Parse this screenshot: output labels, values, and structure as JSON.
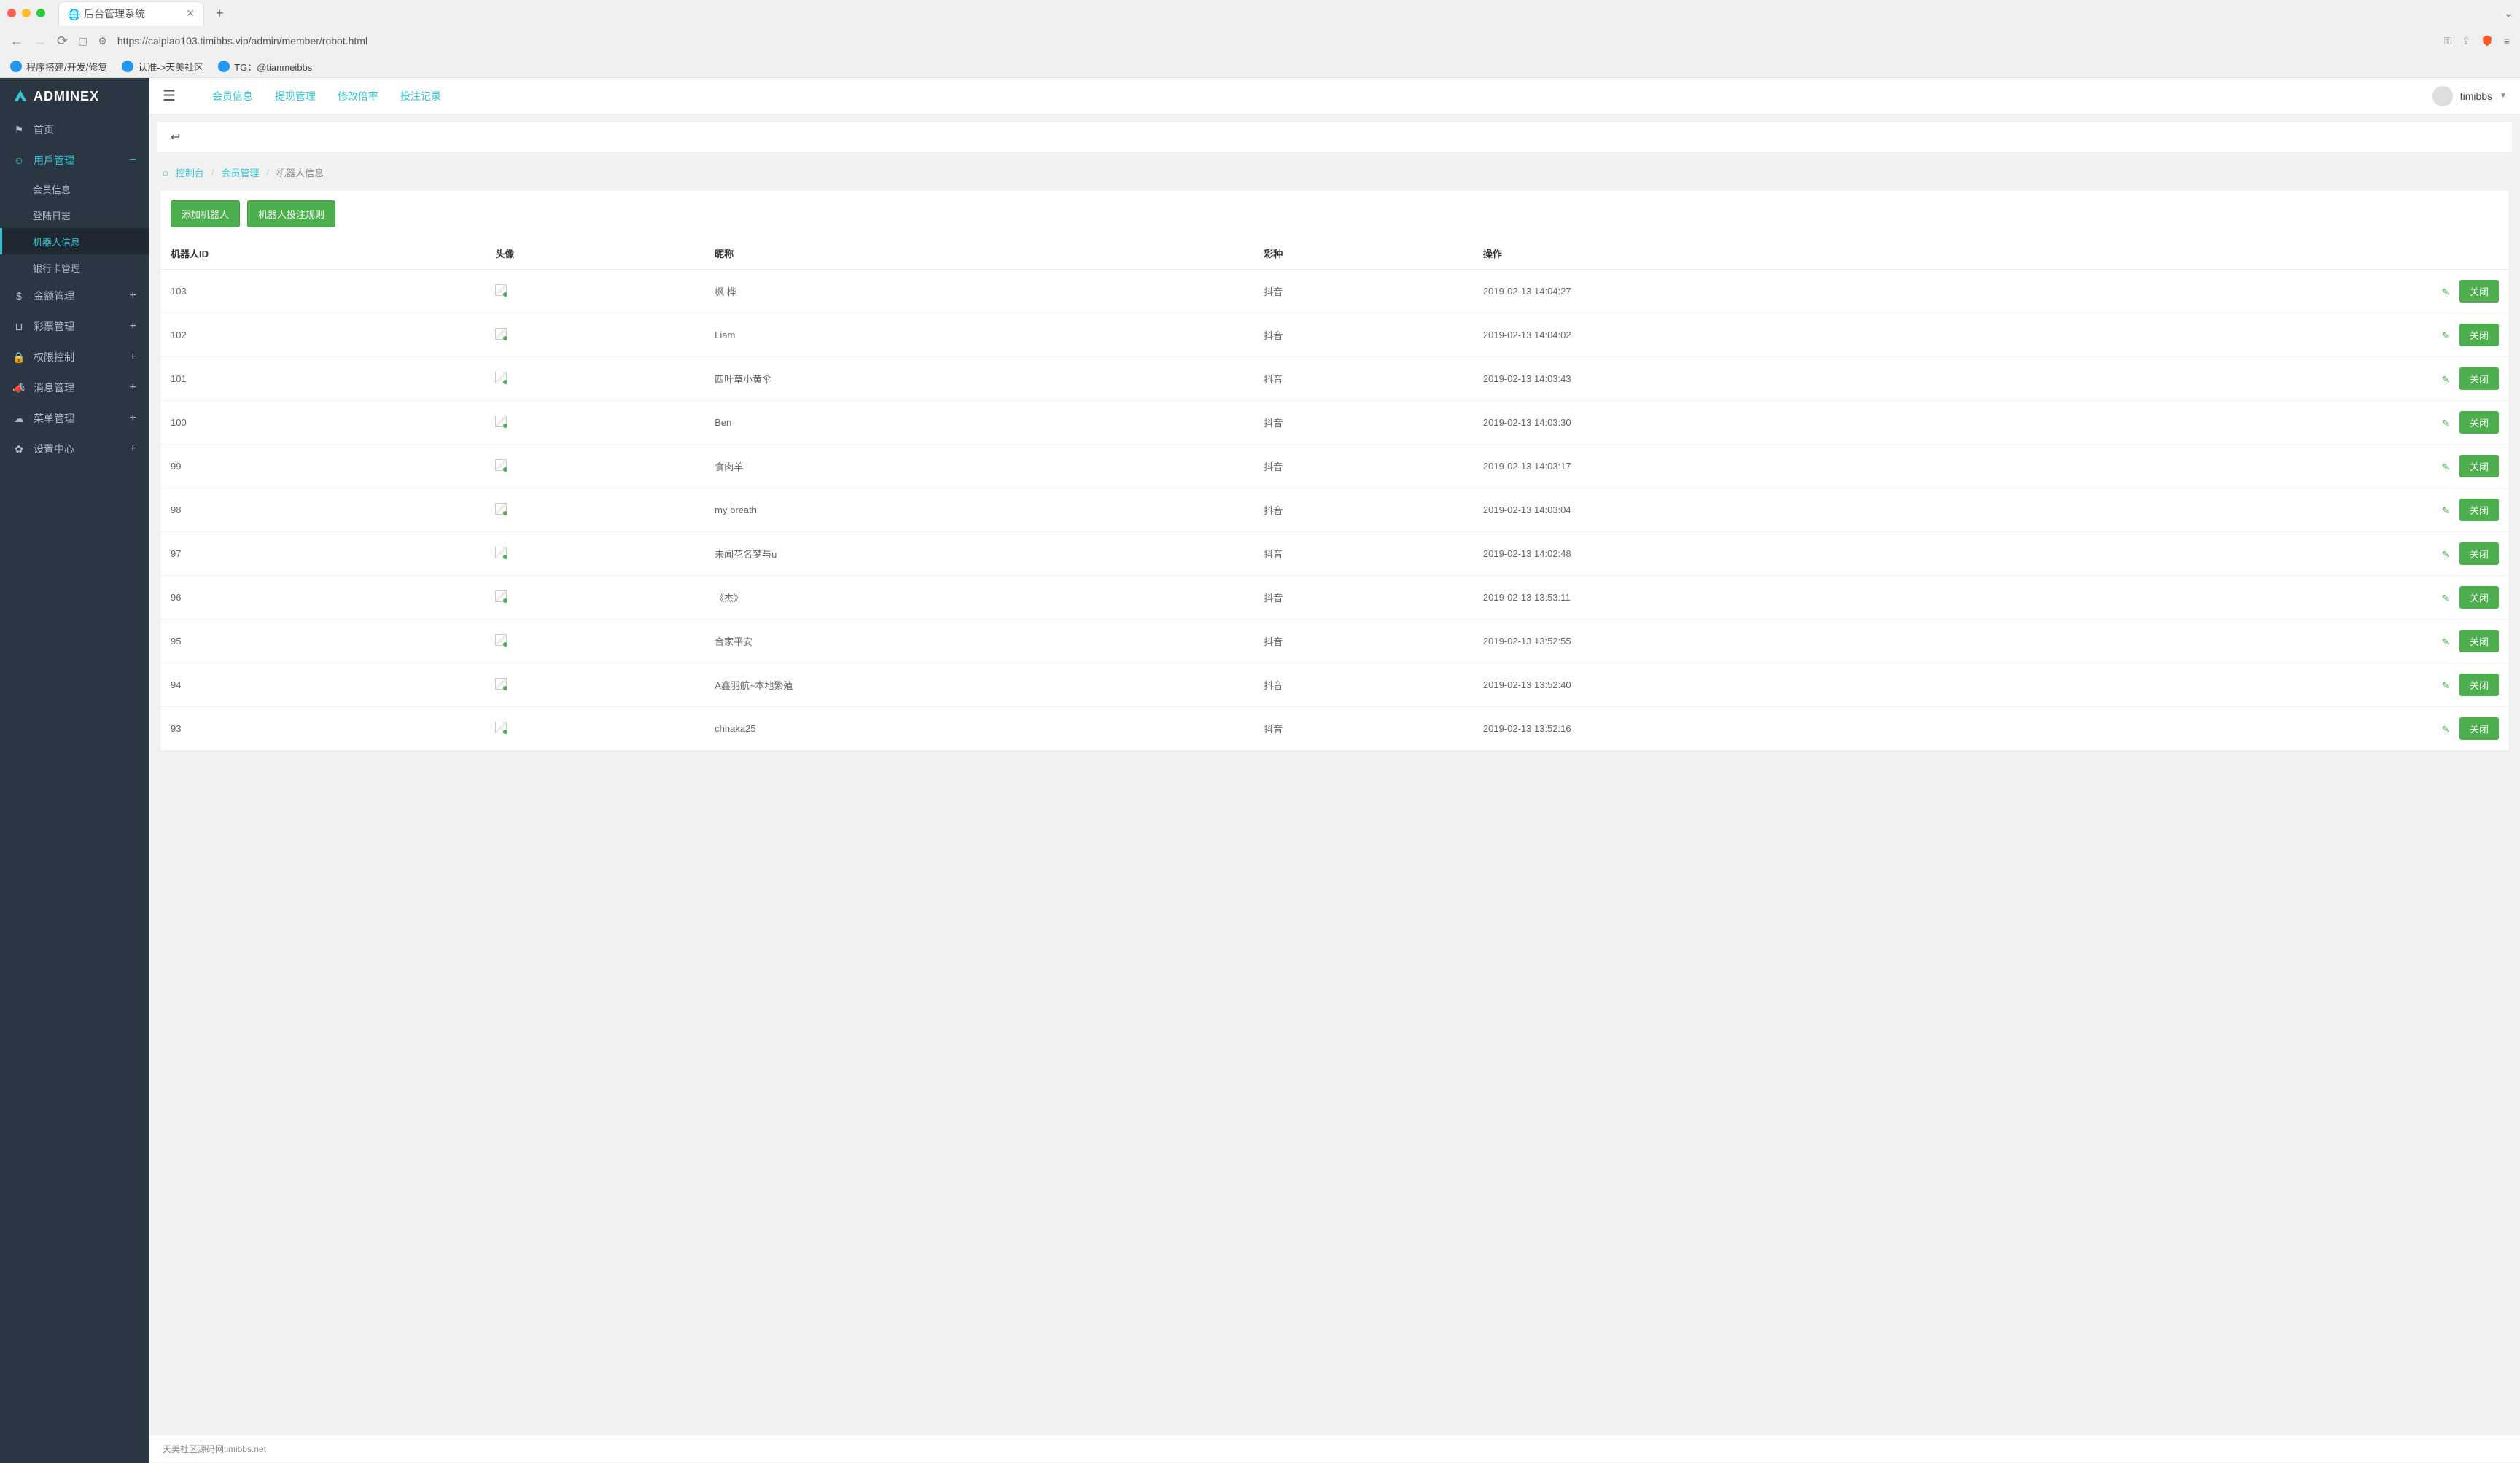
{
  "browser": {
    "tab_title": "后台管理系统",
    "url": "https://caipiao103.timibbs.vip/admin/member/robot.html",
    "bookmarks": [
      "程序搭建/开发/修复",
      "认准->天美社区",
      "TG：@tianmeibbs"
    ]
  },
  "logo": "ADMINEX",
  "sidebar": {
    "items": [
      {
        "label": "首页",
        "icon": "flag"
      },
      {
        "label": "用戶管理",
        "icon": "user",
        "expanded": true,
        "children": [
          {
            "label": "会员信息"
          },
          {
            "label": "登陆日志"
          },
          {
            "label": "机器人信息",
            "active": true
          },
          {
            "label": "银行卡管理"
          }
        ]
      },
      {
        "label": "金额管理",
        "icon": "dollar"
      },
      {
        "label": "彩票管理",
        "icon": "magnet"
      },
      {
        "label": "权限控制",
        "icon": "lock"
      },
      {
        "label": "消息管理",
        "icon": "bullhorn"
      },
      {
        "label": "菜单管理",
        "icon": "cloud"
      },
      {
        "label": "设置中心",
        "icon": "gear"
      }
    ]
  },
  "topbar": {
    "tabs": [
      "会员信息",
      "提现管理",
      "修改倍率",
      "投注记录"
    ],
    "username": "timibbs"
  },
  "breadcrumb": {
    "home": "控制台",
    "parent": "会员管理",
    "current": "机器人信息"
  },
  "actions": {
    "add_robot": "添加机器人",
    "bet_rules": "机器人投注规则"
  },
  "table": {
    "headers": [
      "机器人ID",
      "头像",
      "昵称",
      "彩种",
      "操作"
    ],
    "action_close": "关闭",
    "rows": [
      {
        "id": "103",
        "nick": "枫 桦",
        "type": "抖音",
        "time": "2019-02-13 14:04:27"
      },
      {
        "id": "102",
        "nick": "Liam",
        "type": "抖音",
        "time": "2019-02-13 14:04:02"
      },
      {
        "id": "101",
        "nick": "四叶草小黄伞",
        "type": "抖音",
        "time": "2019-02-13 14:03:43"
      },
      {
        "id": "100",
        "nick": "Ben",
        "type": "抖音",
        "time": "2019-02-13 14:03:30"
      },
      {
        "id": "99",
        "nick": "食肉羊",
        "type": "抖音",
        "time": "2019-02-13 14:03:17"
      },
      {
        "id": "98",
        "nick": "my breath",
        "type": "抖音",
        "time": "2019-02-13 14:03:04"
      },
      {
        "id": "97",
        "nick": "未闻花名梦与u",
        "type": "抖音",
        "time": "2019-02-13 14:02:48"
      },
      {
        "id": "96",
        "nick": "《杰》",
        "type": "抖音",
        "time": "2019-02-13 13:53:11"
      },
      {
        "id": "95",
        "nick": "合家平安",
        "type": "抖音",
        "time": "2019-02-13 13:52:55"
      },
      {
        "id": "94",
        "nick": "A鑫羽航~本地繁殖",
        "type": "抖音",
        "time": "2019-02-13 13:52:40"
      },
      {
        "id": "93",
        "nick": "chhaka25",
        "type": "抖音",
        "time": "2019-02-13 13:52:16"
      }
    ]
  },
  "footer": "天美社区源码网timibbs.net"
}
